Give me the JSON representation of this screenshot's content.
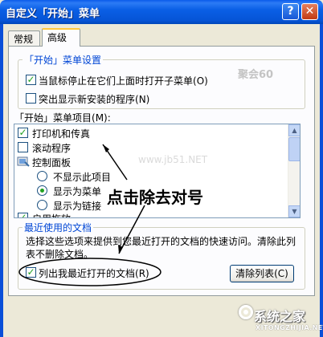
{
  "window": {
    "title": "自定义「开始」菜单",
    "help_glyph": "?",
    "close_glyph": "✕"
  },
  "tabs": [
    {
      "label": "常规",
      "active": false
    },
    {
      "label": "高级",
      "active": true
    }
  ],
  "start_menu_settings": {
    "legend": "「开始」菜单设置",
    "options": [
      {
        "label": "当鼠标停止在它们上面时打开子菜单",
        "accel": "(O)",
        "checked": true
      },
      {
        "label": "突出显示新安装的程序",
        "accel": "(N)",
        "checked": false
      }
    ]
  },
  "items_list": {
    "label": "「开始」菜单项目",
    "accel": "(M)",
    "suffix": ":",
    "items": [
      {
        "label": "打印机和传真",
        "type": "checkbox",
        "checked": true
      },
      {
        "label": "滚动程序",
        "type": "checkbox",
        "checked": false
      },
      {
        "label": "控制面板",
        "type": "header"
      },
      {
        "label": "不显示此项目",
        "type": "radio",
        "selected": false
      },
      {
        "label": "显示为菜单",
        "type": "radio",
        "selected": true
      },
      {
        "label": "显示为链接",
        "type": "radio",
        "selected": false
      },
      {
        "label": "启用拖放",
        "type": "checkbox",
        "checked": true
      }
    ]
  },
  "recent_documents": {
    "legend": "最近使用的文档",
    "description_line1": "选择这些选项来提供到您最近打开的文档的快速访问。清除此列",
    "description_line2": "表不删除文档。",
    "list_checkbox_label": "列出我最近打开的文档",
    "list_checkbox_accel": "(R)",
    "list_checked": true,
    "clear_button_label": "清除列表",
    "clear_button_accel": "(C)"
  },
  "annotation": {
    "text": "点击除去对号"
  },
  "watermarks": {
    "top_right": "聚会60",
    "mid": "www.jb51.NET",
    "brand_name": "系统之家",
    "brand_url": "XITONGZHIJIA.NET"
  },
  "colors": {
    "titlebar": "#0A5FE6",
    "dialog_bg": "#ECE9D8",
    "legend_text": "#0046D5",
    "check_mark": "#21A121",
    "frame": "#0A4FD8"
  }
}
